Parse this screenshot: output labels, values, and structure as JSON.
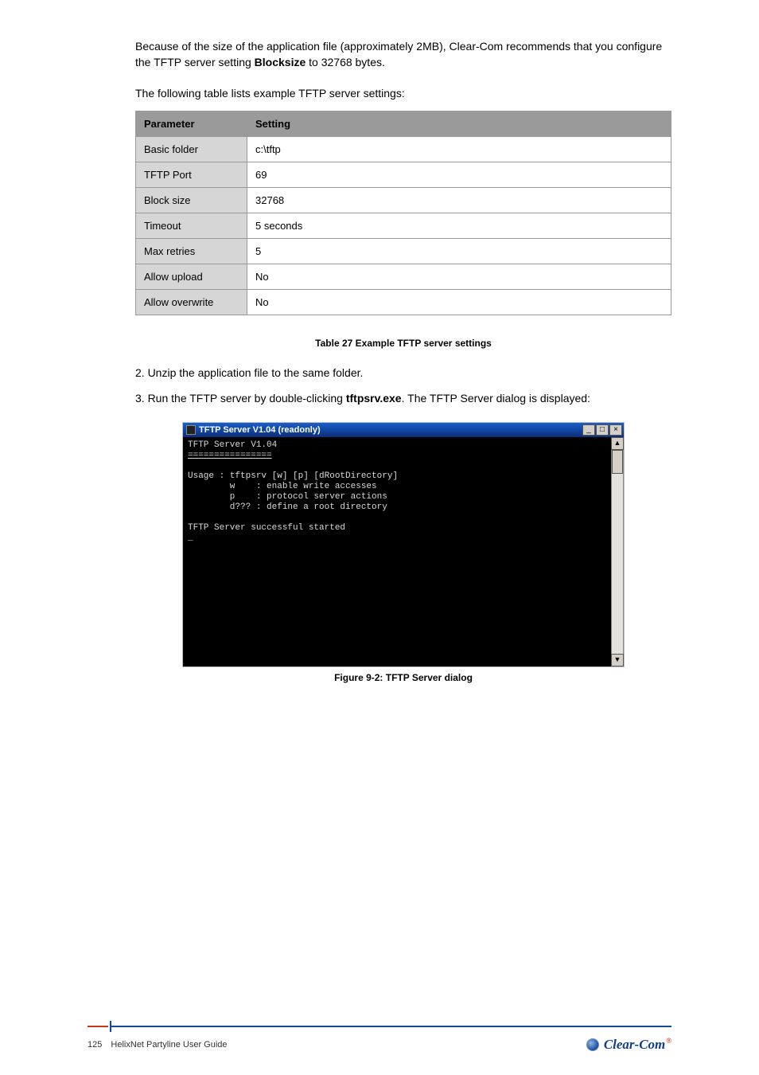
{
  "body": {
    "lead1": "Because of the size of the application file (approximately 2MB), Clear-Com recommends that you configure the TFTP server setting ",
    "lead_bold": "Blocksize",
    "lead2": " to 32768 bytes.",
    "tbl_intro": "The following table lists example TFTP server settings:",
    "steps": {
      "s2": "2.  Unzip the application file to the same folder.",
      "s3a": "3.  Run the TFTP server by double-clicking ",
      "s3b": ". The TFTP Server dialog is displayed:",
      "tftp_file": "tftpsrv.exe"
    }
  },
  "table": {
    "headers": {
      "c0": "Parameter",
      "c1": "Setting"
    },
    "rows": [
      {
        "c0": "Basic folder",
        "c1": "c:\\tftp"
      },
      {
        "c0": "TFTP Port",
        "c1": "69"
      },
      {
        "c0": "Block size",
        "c1": "32768"
      },
      {
        "c0": "Timeout",
        "c1": "5 seconds"
      },
      {
        "c0": "Max retries",
        "c1": "5"
      },
      {
        "c0": "Allow upload",
        "c1": "No"
      },
      {
        "c0": "Allow overwrite",
        "c1": "No"
      }
    ]
  },
  "table_caption": "Table 27 Example TFTP server settings",
  "figure_caption": "Figure 9-2: TFTP Server dialog",
  "terminal": {
    "title": "TFTP Server V1.04 (readonly)",
    "l1": "TFTP Server V1.04",
    "sep": "================",
    "l2": "Usage : tftpsrv [w] [p] [dRootDirectory]",
    "l3": "        w    : enable write accesses",
    "l4": "        p    : protocol server actions",
    "l5": "        d??? : define a root directory",
    "l6": "TFTP Server successful started",
    "cursor": "_"
  },
  "footer": {
    "page": "125",
    "title": "HelixNet Partyline User Guide",
    "brand": "Clear-Com",
    "reg": "®"
  }
}
